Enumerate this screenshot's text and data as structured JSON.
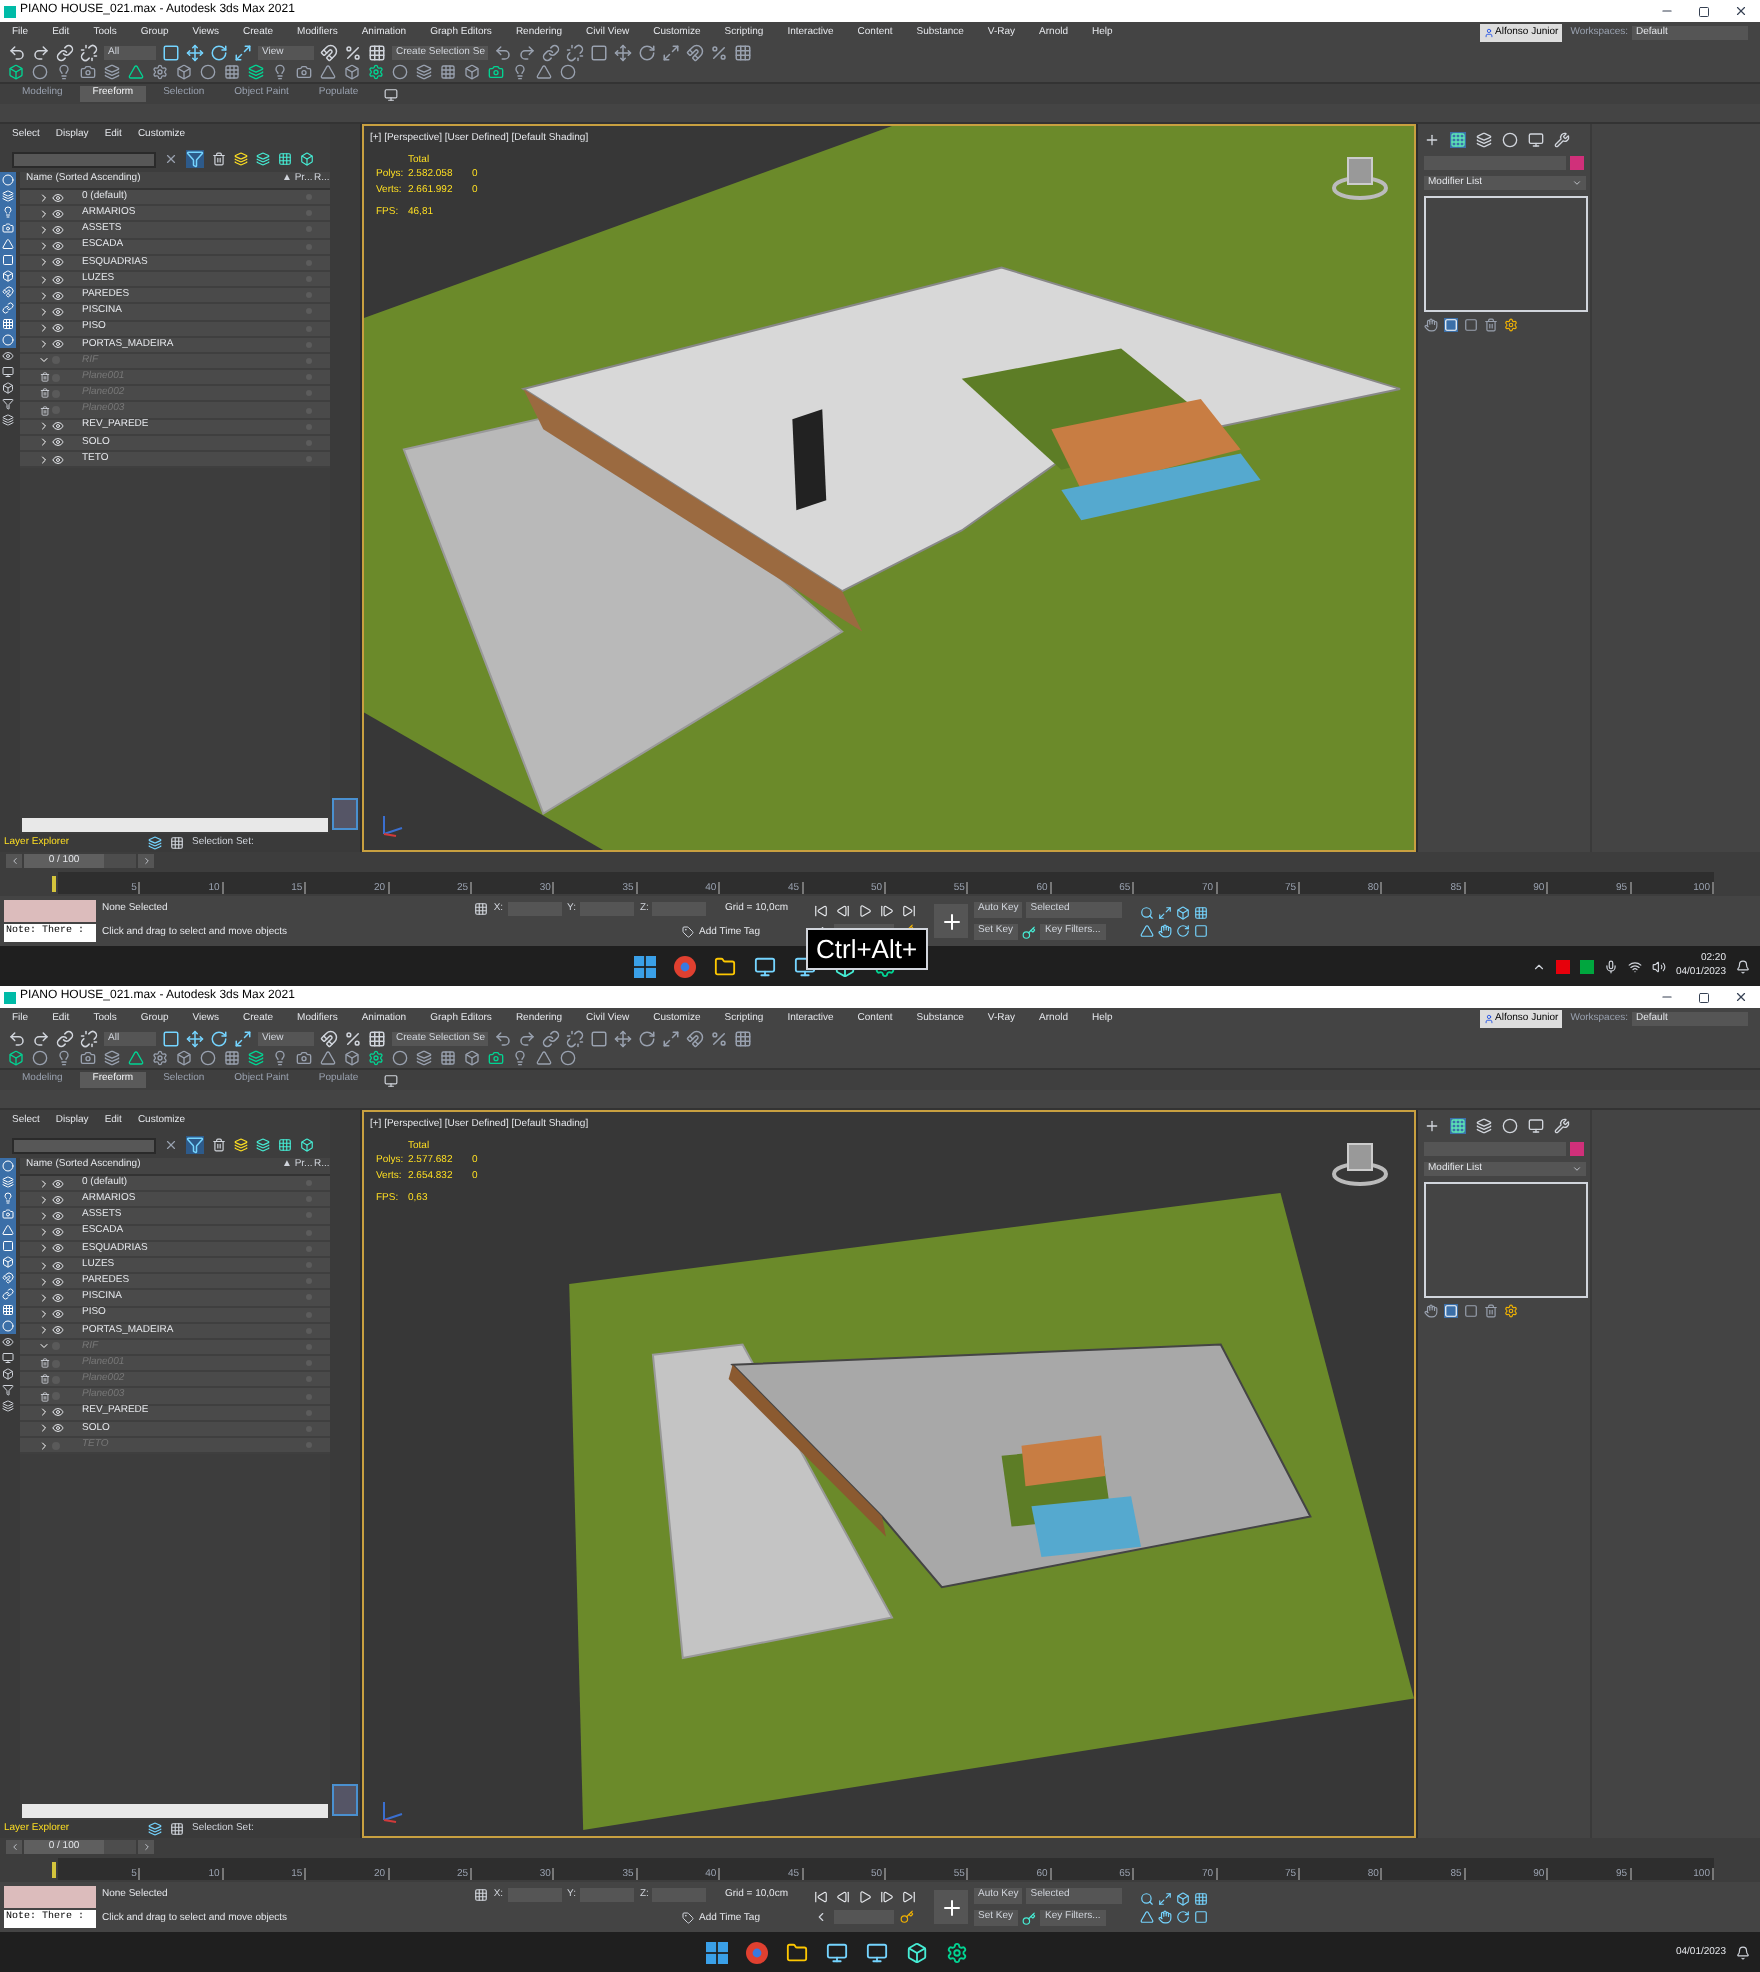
{
  "screens": [
    {
      "window": {
        "title": "PIANO HOUSE_021.max - Autodesk 3ds Max 2021"
      },
      "menu": [
        "File",
        "Edit",
        "Tools",
        "Group",
        "Views",
        "Create",
        "Modifiers",
        "Animation",
        "Graph Editors",
        "Rendering",
        "Civil View",
        "Customize",
        "Scripting",
        "Interactive",
        "Content",
        "Substance",
        "V-Ray",
        "Arnold",
        "Help"
      ],
      "user": "Alfonso Junior",
      "workspaces": {
        "label": "Workspaces:",
        "value": "Default"
      },
      "toolbar": {
        "filter": "All",
        "reference": "View",
        "selection_set": "Create Selection Se"
      },
      "ribbon_tabs": [
        {
          "label": "Modeling",
          "selected": false
        },
        {
          "label": "Freeform",
          "selected": true
        },
        {
          "label": "Selection",
          "selected": false
        },
        {
          "label": "Object Paint",
          "selected": false
        },
        {
          "label": "Populate",
          "selected": false
        }
      ],
      "explorer": {
        "menu": [
          "Select",
          "Display",
          "Edit",
          "Customize"
        ],
        "columns": [
          "Name (Sorted Ascending)",
          "▲ Pr...",
          "R..."
        ],
        "layers": [
          {
            "name": "0 (default)",
            "visible": true,
            "expanded": false
          },
          {
            "name": "ARMARIOS",
            "visible": true,
            "expanded": false
          },
          {
            "name": "ASSETS",
            "visible": true,
            "expanded": false
          },
          {
            "name": "ESCADA",
            "visible": true,
            "expanded": false
          },
          {
            "name": "ESQUADRIAS",
            "visible": true,
            "expanded": false
          },
          {
            "name": "LUZES",
            "visible": true,
            "expanded": false
          },
          {
            "name": "PAREDES",
            "visible": true,
            "expanded": false
          },
          {
            "name": "PISCINA",
            "visible": true,
            "expanded": false
          },
          {
            "name": "PISO",
            "visible": true,
            "expanded": false
          },
          {
            "name": "PORTAS_MADEIRA",
            "visible": true,
            "expanded": false
          },
          {
            "name": "RIF",
            "visible": false,
            "expanded": true,
            "children": [
              {
                "name": "Plane001",
                "visible": false
              },
              {
                "name": "Plane002",
                "visible": false
              },
              {
                "name": "Plane003",
                "visible": false
              }
            ]
          },
          {
            "name": "REV_PAREDE",
            "visible": true,
            "expanded": false
          },
          {
            "name": "SOLO",
            "visible": true,
            "expanded": false
          },
          {
            "name": "TETO",
            "visible": true,
            "expanded": false
          }
        ]
      },
      "layer_bar": {
        "title": "Layer Explorer",
        "selection_set": "Selection Set:"
      },
      "viewport": {
        "label": "[+] [Perspective] [User Defined] [Default Shading]",
        "roof_visible": true,
        "stats": {
          "heading": "Total",
          "rows": [
            {
              "label": "Polys:",
              "value": "2.582.058",
              "selected": "0"
            },
            {
              "label": "Verts:",
              "value": "2.661.992",
              "selected": "0"
            }
          ],
          "fps_label": "FPS:",
          "fps": "46,81"
        }
      },
      "command_panel": {
        "modifier_list": "Modifier List"
      },
      "timeline": {
        "position": "0 / 100",
        "level": 0,
        "ticks": [
          "5",
          "10",
          "15",
          "20",
          "25",
          "30",
          "35",
          "40",
          "45",
          "50",
          "55",
          "60",
          "65",
          "70",
          "75",
          "80",
          "85",
          "90",
          "95",
          "100"
        ]
      },
      "status": {
        "note": "Note: There :",
        "selection": "None Selected",
        "prompt": "Click and drag to select and move objects",
        "coords": [
          "X:",
          "Y:",
          "Z:"
        ],
        "grid": "Grid = 10,0cm",
        "time_tag": "Add Time Tag",
        "auto_key": "Auto Key",
        "key_mode": "Selected",
        "set_key": "Set Key",
        "key_filters": "Key Filters..."
      },
      "key_overlay": "Ctrl+Alt+",
      "clock": {
        "time": "02:20",
        "date": "04/01/2023"
      }
    },
    {
      "window": {
        "title": "PIANO HOUSE_021.max - Autodesk 3ds Max 2021"
      },
      "menu": [
        "File",
        "Edit",
        "Tools",
        "Group",
        "Views",
        "Create",
        "Modifiers",
        "Animation",
        "Graph Editors",
        "Rendering",
        "Civil View",
        "Customize",
        "Scripting",
        "Interactive",
        "Content",
        "Substance",
        "V-Ray",
        "Arnold",
        "Help"
      ],
      "user": "Alfonso Junior",
      "workspaces": {
        "label": "Workspaces:",
        "value": "Default"
      },
      "toolbar": {
        "filter": "All",
        "reference": "View",
        "selection_set": "Create Selection Se"
      },
      "ribbon_tabs": [
        {
          "label": "Modeling",
          "selected": false
        },
        {
          "label": "Freeform",
          "selected": true
        },
        {
          "label": "Selection",
          "selected": false
        },
        {
          "label": "Object Paint",
          "selected": false
        },
        {
          "label": "Populate",
          "selected": false
        }
      ],
      "explorer": {
        "menu": [
          "Select",
          "Display",
          "Edit",
          "Customize"
        ],
        "columns": [
          "Name (Sorted Ascending)",
          "▲ Pr...",
          "R..."
        ],
        "layers": [
          {
            "name": "0 (default)",
            "visible": true,
            "expanded": false
          },
          {
            "name": "ARMARIOS",
            "visible": true,
            "expanded": false
          },
          {
            "name": "ASSETS",
            "visible": true,
            "expanded": false
          },
          {
            "name": "ESCADA",
            "visible": true,
            "expanded": false
          },
          {
            "name": "ESQUADRIAS",
            "visible": true,
            "expanded": false
          },
          {
            "name": "LUZES",
            "visible": true,
            "expanded": false
          },
          {
            "name": "PAREDES",
            "visible": true,
            "expanded": false
          },
          {
            "name": "PISCINA",
            "visible": true,
            "expanded": false
          },
          {
            "name": "PISO",
            "visible": true,
            "expanded": false
          },
          {
            "name": "PORTAS_MADEIRA",
            "visible": true,
            "expanded": false
          },
          {
            "name": "RIF",
            "visible": false,
            "expanded": true,
            "children": [
              {
                "name": "Plane001",
                "visible": false
              },
              {
                "name": "Plane002",
                "visible": false
              },
              {
                "name": "Plane003",
                "visible": false
              }
            ]
          },
          {
            "name": "REV_PAREDE",
            "visible": true,
            "expanded": false
          },
          {
            "name": "SOLO",
            "visible": true,
            "expanded": false
          },
          {
            "name": "TETO",
            "visible": false,
            "expanded": false
          }
        ]
      },
      "layer_bar": {
        "title": "Layer Explorer",
        "selection_set": "Selection Set:"
      },
      "viewport": {
        "label": "[+] [Perspective] [User Defined] [Default Shading]",
        "roof_visible": false,
        "stats": {
          "heading": "Total",
          "rows": [
            {
              "label": "Polys:",
              "value": "2.577.682",
              "selected": "0"
            },
            {
              "label": "Verts:",
              "value": "2.654.832",
              "selected": "0"
            }
          ],
          "fps_label": "FPS:",
          "fps": "0,63"
        }
      },
      "command_panel": {
        "modifier_list": "Modifier List"
      },
      "timeline": {
        "position": "0 / 100",
        "level": 0,
        "ticks": [
          "5",
          "10",
          "15",
          "20",
          "25",
          "30",
          "35",
          "40",
          "45",
          "50",
          "55",
          "60",
          "65",
          "70",
          "75",
          "80",
          "85",
          "90",
          "95",
          "100"
        ]
      },
      "status": {
        "note": "Note: There :",
        "selection": "None Selected",
        "prompt": "Click and drag to select and move objects",
        "coords": [
          "X:",
          "Y:",
          "Z:"
        ],
        "grid": "Grid = 10,0cm",
        "time_tag": "Add Time Tag",
        "auto_key": "Auto Key",
        "key_mode": "Selected",
        "set_key": "Set Key",
        "key_filters": "Key Filters..."
      },
      "clock": {
        "date": "04/01/2023"
      }
    }
  ]
}
